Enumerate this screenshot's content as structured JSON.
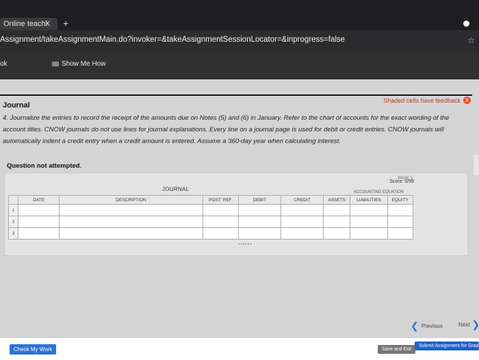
{
  "browser": {
    "tab_title": "Online teachi",
    "tab_close": "X",
    "new_tab": "+",
    "url_main": "Assignment/takeAssignmentMain.do?invoker=&takeAssignmentSessionLocator=&inprogress=false",
    "star": "☆"
  },
  "appbar": {
    "left_label": "ok",
    "show_me_how": "Show Me How"
  },
  "content": {
    "feedback_label": "Shaded cells have feedback",
    "feedback_icon": "X",
    "journal_heading": "Journal",
    "instructions": "4. Journalize the entries to record the receipt of the amounts due on Notes (5) and (6) in January. Refer to the chart of accounts for the exact wording of the account titles. CNOW journals do not use lines for journal explanations. Every line on a journal page is used for debit or credit entries. CNOW journals will automatically indent a credit entry when a credit amount is entered. Assume a 360-day year when calculating interest.",
    "question_status": "Question not attempted."
  },
  "journal": {
    "page_label": "PAGE 1",
    "score": "Score: 0/99",
    "title": "JOURNAL",
    "equation_title": "ACCOUNTING EQUATION",
    "columns": [
      "DATE",
      "DESCRIPTION",
      "POST. REF.",
      "DEBIT",
      "CREDIT",
      "ASSETS",
      "LIABILITIES",
      "EQUITY"
    ],
    "rows": [
      "1",
      "2",
      "3"
    ]
  },
  "nav": {
    "previous": "Previous",
    "next": "Next"
  },
  "buttons": {
    "check_my_work": "Check My Work",
    "save_and_exit": "Save and Exit",
    "submit": "Submit Assignment for Grading"
  }
}
